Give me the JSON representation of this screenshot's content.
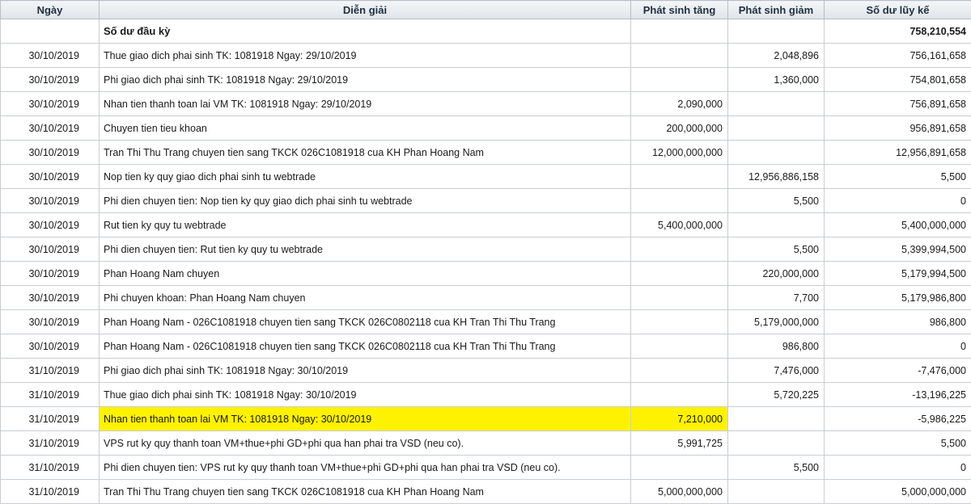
{
  "table": {
    "columns": [
      "Ngày",
      "Diễn giải",
      "Phát sinh tăng",
      "Phát sinh giảm",
      "Số dư lũy kế"
    ],
    "opening": {
      "label": "Số dư đầu kỳ",
      "balance": "758,210,554"
    },
    "highlight_color": "#fff200",
    "rows": [
      {
        "date": "30/10/2019",
        "desc": "Thue giao dich phai sinh TK: 1081918 Ngay: 29/10/2019",
        "inc": "",
        "dec": "2,048,896",
        "bal": "756,161,658"
      },
      {
        "date": "30/10/2019",
        "desc": "Phi giao dich phai sinh TK: 1081918 Ngay: 29/10/2019",
        "inc": "",
        "dec": "1,360,000",
        "bal": "754,801,658"
      },
      {
        "date": "30/10/2019",
        "desc": "Nhan tien thanh toan lai VM TK: 1081918 Ngay: 29/10/2019",
        "inc": "2,090,000",
        "dec": "",
        "bal": "756,891,658"
      },
      {
        "date": "30/10/2019",
        "desc": "Chuyen tien tieu khoan",
        "inc": "200,000,000",
        "dec": "",
        "bal": "956,891,658"
      },
      {
        "date": "30/10/2019",
        "desc": "Tran Thi Thu Trang chuyen tien sang TKCK 026C1081918 cua KH Phan Hoang Nam",
        "inc": "12,000,000,000",
        "dec": "",
        "bal": "12,956,891,658"
      },
      {
        "date": "30/10/2019",
        "desc": "Nop tien ky quy giao dich phai sinh tu webtrade",
        "inc": "",
        "dec": "12,956,886,158",
        "bal": "5,500"
      },
      {
        "date": "30/10/2019",
        "desc": "Phi dien chuyen tien: Nop tien ky quy giao dich phai sinh tu webtrade",
        "inc": "",
        "dec": "5,500",
        "bal": "0"
      },
      {
        "date": "30/10/2019",
        "desc": "Rut tien ky quy tu webtrade",
        "inc": "5,400,000,000",
        "dec": "",
        "bal": "5,400,000,000"
      },
      {
        "date": "30/10/2019",
        "desc": "Phi dien chuyen tien: Rut tien ky quy tu webtrade",
        "inc": "",
        "dec": "5,500",
        "bal": "5,399,994,500"
      },
      {
        "date": "30/10/2019",
        "desc": "Phan Hoang Nam chuyen",
        "inc": "",
        "dec": "220,000,000",
        "bal": "5,179,994,500"
      },
      {
        "date": "30/10/2019",
        "desc": "Phi chuyen khoan: Phan Hoang Nam chuyen",
        "inc": "",
        "dec": "7,700",
        "bal": "5,179,986,800"
      },
      {
        "date": "30/10/2019",
        "desc": "Phan Hoang Nam - 026C1081918 chuyen tien sang TKCK 026C0802118 cua KH Tran Thi Thu Trang",
        "inc": "",
        "dec": "5,179,000,000",
        "bal": "986,800"
      },
      {
        "date": "30/10/2019",
        "desc": "Phan Hoang Nam - 026C1081918 chuyen tien sang TKCK 026C0802118 cua KH Tran Thi Thu Trang",
        "inc": "",
        "dec": "986,800",
        "bal": "0"
      },
      {
        "date": "31/10/2019",
        "desc": "Phi giao dich phai sinh TK: 1081918 Ngay: 30/10/2019",
        "inc": "",
        "dec": "7,476,000",
        "bal": "-7,476,000"
      },
      {
        "date": "31/10/2019",
        "desc": "Thue giao dich phai sinh TK: 1081918 Ngay: 30/10/2019",
        "inc": "",
        "dec": "5,720,225",
        "bal": "-13,196,225"
      },
      {
        "date": "31/10/2019",
        "desc": "Nhan tien thanh toan lai VM TK: 1081918 Ngay: 30/10/2019",
        "inc": "7,210,000",
        "dec": "",
        "bal": "-5,986,225",
        "highlight": true
      },
      {
        "date": "31/10/2019",
        "desc": "VPS rut ky quy thanh toan VM+thue+phi GD+phi qua han phai tra VSD (neu co).",
        "inc": "5,991,725",
        "dec": "",
        "bal": "5,500"
      },
      {
        "date": "31/10/2019",
        "desc": "Phi dien chuyen tien: VPS rut ky quy thanh toan VM+thue+phi GD+phi qua han phai tra VSD (neu co).",
        "inc": "",
        "dec": "5,500",
        "bal": "0"
      },
      {
        "date": "31/10/2019",
        "desc": "Tran Thi Thu Trang chuyen tien sang TKCK 026C1081918 cua KH Phan Hoang Nam",
        "inc": "5,000,000,000",
        "dec": "",
        "bal": "5,000,000,000"
      }
    ]
  }
}
